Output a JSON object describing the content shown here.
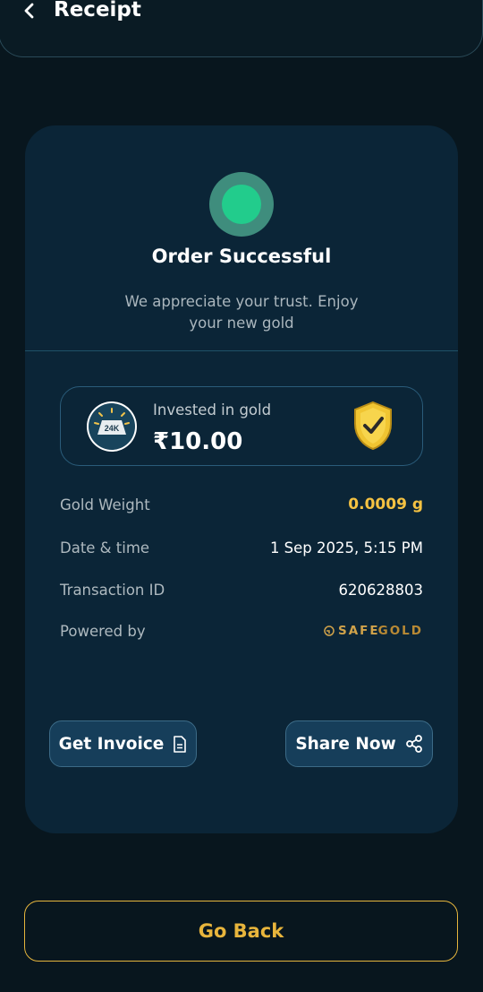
{
  "header": {
    "title": "Receipt"
  },
  "status": {
    "title": "Order Successful",
    "message_line1": "We appreciate your trust. Enjoy",
    "message_line2": "your new gold"
  },
  "investment": {
    "badge_text": "24K",
    "label": "Invested in gold",
    "amount": "₹10.00"
  },
  "details": [
    {
      "label": "Gold Weight",
      "value": "0.0009 g"
    },
    {
      "label": "Date & time",
      "value": "1 Sep 2025, 5:15 PM"
    },
    {
      "label": "Transaction ID",
      "value": "620628803"
    },
    {
      "label": "Powered by",
      "value": "SAFEGOLD"
    }
  ],
  "brand": {
    "part1": "SAFE",
    "part2": "GOLD"
  },
  "actions": {
    "invoice_label": "Get Invoice",
    "share_label": "Share Now",
    "go_back_label": "Go Back"
  },
  "colors": {
    "background": "#08161e",
    "card": "#0b2537",
    "success": "#22cc8c",
    "gold_accent": "#f5c242",
    "button": "#163e5a"
  }
}
